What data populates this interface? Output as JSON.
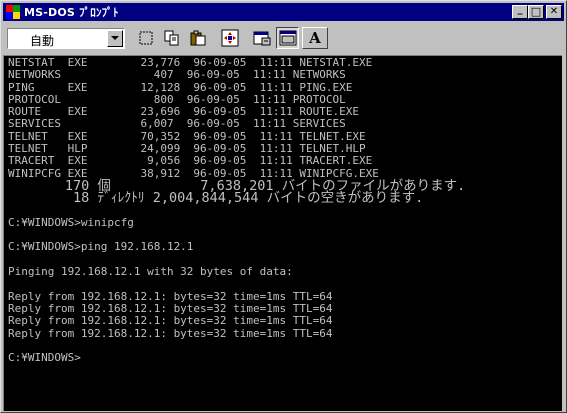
{
  "window": {
    "title": "MS-DOS ﾌﾟﾛﾝﾌﾟﾄ",
    "minimize_label": "_",
    "maximize_label": "□",
    "close_label": "✕"
  },
  "toolbar": {
    "font_size_value": "自動",
    "font_button_label": "A",
    "tools": [
      "mark-icon",
      "copy-icon",
      "paste-icon",
      "fullscreen-icon",
      "properties-icon",
      "background-icon"
    ]
  },
  "console": {
    "lines": [
      "NETSTAT  EXE        23,776  96-09-05  11:11 NETSTAT.EXE",
      "NETWORKS              407  96-09-05  11:11 NETWORKS",
      "PING     EXE        12,128  96-09-05  11:11 PING.EXE",
      "PROTOCOL              800  96-09-05  11:11 PROTOCOL",
      "ROUTE    EXE        23,696  96-09-05  11:11 ROUTE.EXE",
      "SERVICES            6,007  96-09-05  11:11 SERVICES",
      "TELNET   EXE        70,352  96-09-05  11:11 TELNET.EXE",
      "TELNET   HLP        24,099  96-09-05  11:11 TELNET.HLP",
      "TRACERT  EXE         9,056  96-09-05  11:11 TRACERT.EXE",
      "WINIPCFG EXE        38,912  96-09-05  11:11 WINIPCFG.EXE",
      "       170 個           7,638,201 バイトのファイルがあります.",
      "        18 ﾃﾞｨﾚｸﾄﾘ 2,004,844,544 バイトの空きがあります.",
      "",
      "C:¥WINDOWS>winipcfg",
      "",
      "C:¥WINDOWS>ping 192.168.12.1",
      "",
      "Pinging 192.168.12.1 with 32 bytes of data:",
      "",
      "Reply from 192.168.12.1: bytes=32 time=1ms TTL=64",
      "Reply from 192.168.12.1: bytes=32 time=1ms TTL=64",
      "Reply from 192.168.12.1: bytes=32 time=1ms TTL=64",
      "Reply from 192.168.12.1: bytes=32 time=1ms TTL=64",
      "",
      "C:¥WINDOWS>"
    ]
  },
  "colors": {
    "titlebar": "#000080",
    "console_bg": "#000000",
    "console_fg": "#c0c0c0",
    "chrome": "#c0c0c0"
  }
}
